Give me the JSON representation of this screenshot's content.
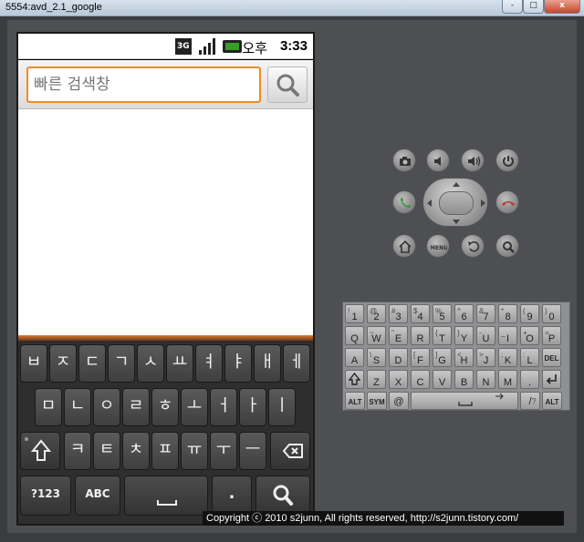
{
  "window": {
    "title": "5554:avd_2.1_google",
    "min_label": "-",
    "max_label": "□",
    "close_label": "x"
  },
  "status": {
    "network": "3G",
    "ampm": "오후",
    "time": "3:33"
  },
  "search": {
    "placeholder": "빠른 검색창"
  },
  "keyboard": {
    "row1": [
      "ㅂ",
      "ㅈ",
      "ㄷ",
      "ㄱ",
      "ㅅ",
      "ㅛ",
      "ㅕ",
      "ㅑ",
      "ㅐ",
      "ㅔ"
    ],
    "row2": [
      "ㅁ",
      "ㄴ",
      "ㅇ",
      "ㄹ",
      "ㅎ",
      "ㅗ",
      "ㅓ",
      "ㅏ",
      "ㅣ"
    ],
    "row3": [
      "ㅋ",
      "ㅌ",
      "ㅊ",
      "ㅍ",
      "ㅠ",
      "ㅜ",
      "ㅡ"
    ],
    "symbols_label": "?123",
    "lang_label": "ABC",
    "period_label": "."
  },
  "qwerty": {
    "row1": [
      [
        "1",
        "!"
      ],
      [
        "2",
        "@"
      ],
      [
        "3",
        "#"
      ],
      [
        "4",
        "$"
      ],
      [
        "5",
        "%"
      ],
      [
        "6",
        "^"
      ],
      [
        "7",
        "&"
      ],
      [
        "8",
        "*"
      ],
      [
        "9",
        "("
      ],
      [
        "0",
        ")"
      ]
    ],
    "row2": [
      [
        "Q",
        ""
      ],
      [
        "W",
        "~"
      ],
      [
        "E",
        "\""
      ],
      [
        "R",
        ""
      ],
      [
        "T",
        "{"
      ],
      [
        "Y",
        "}"
      ],
      [
        "U",
        "-"
      ],
      [
        "I",
        "_"
      ],
      [
        "O",
        "+"
      ],
      [
        "P",
        "="
      ]
    ],
    "row3": [
      [
        "A",
        ""
      ],
      [
        "S",
        "\\"
      ],
      [
        "D",
        ""
      ],
      [
        "F",
        "["
      ],
      [
        "G",
        "]"
      ],
      [
        "H",
        "<"
      ],
      [
        "J",
        ">"
      ],
      [
        "K",
        ";"
      ],
      [
        "L",
        ":"
      ],
      [
        "DEL",
        ""
      ]
    ],
    "row4": [
      [
        "Z",
        ""
      ],
      [
        "X",
        ""
      ],
      [
        "C",
        ""
      ],
      [
        "V",
        ""
      ],
      [
        "B",
        ""
      ],
      [
        "N",
        ""
      ],
      [
        "M",
        ""
      ],
      [
        ".",
        ""
      ]
    ],
    "alt_label": "ALT",
    "sym_label": "SYM",
    "at_label": "@",
    "slash_label": "/",
    "comma_label": ",",
    "question_label": "?"
  },
  "footer": {
    "copyright": "Copyright ⓒ 2010 s2junn, All rights reserved, http://s2junn.tistory.com/"
  },
  "colors": {
    "search_border": "#f08a22",
    "call_green": "#2e9a3a",
    "end_red": "#c8302a"
  }
}
